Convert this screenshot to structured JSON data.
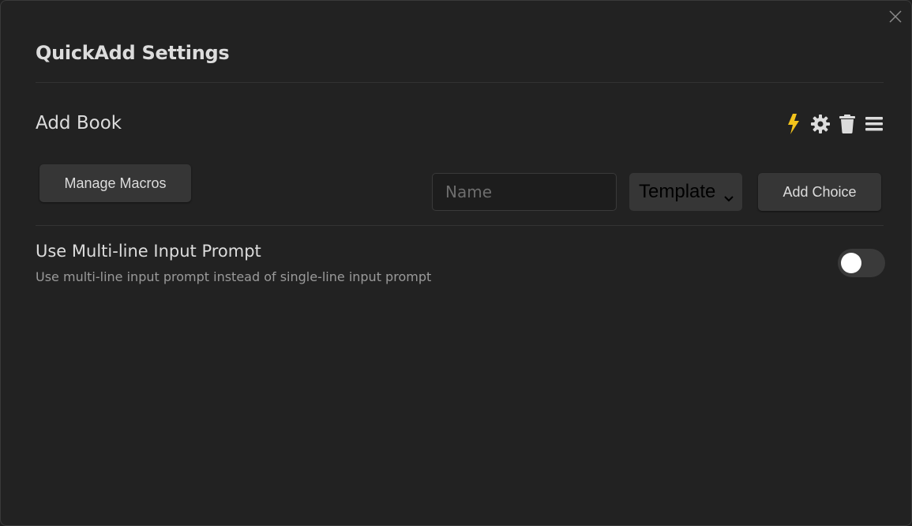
{
  "modal": {
    "title": "QuickAdd Settings"
  },
  "choice": {
    "name": "Add Book",
    "icons": [
      "lightning-icon",
      "gear-icon",
      "trash-icon",
      "drag-handle-icon"
    ],
    "lightning_color": "#f2c31b"
  },
  "toolbar": {
    "manage_macros_label": "Manage Macros",
    "name_placeholder": "Name",
    "name_value": "",
    "type_selected": "Template",
    "add_choice_label": "Add Choice"
  },
  "settings": {
    "multiline": {
      "name": "Use Multi-line Input Prompt",
      "description": "Use multi-line input prompt instead of single-line input prompt",
      "enabled": false
    }
  }
}
